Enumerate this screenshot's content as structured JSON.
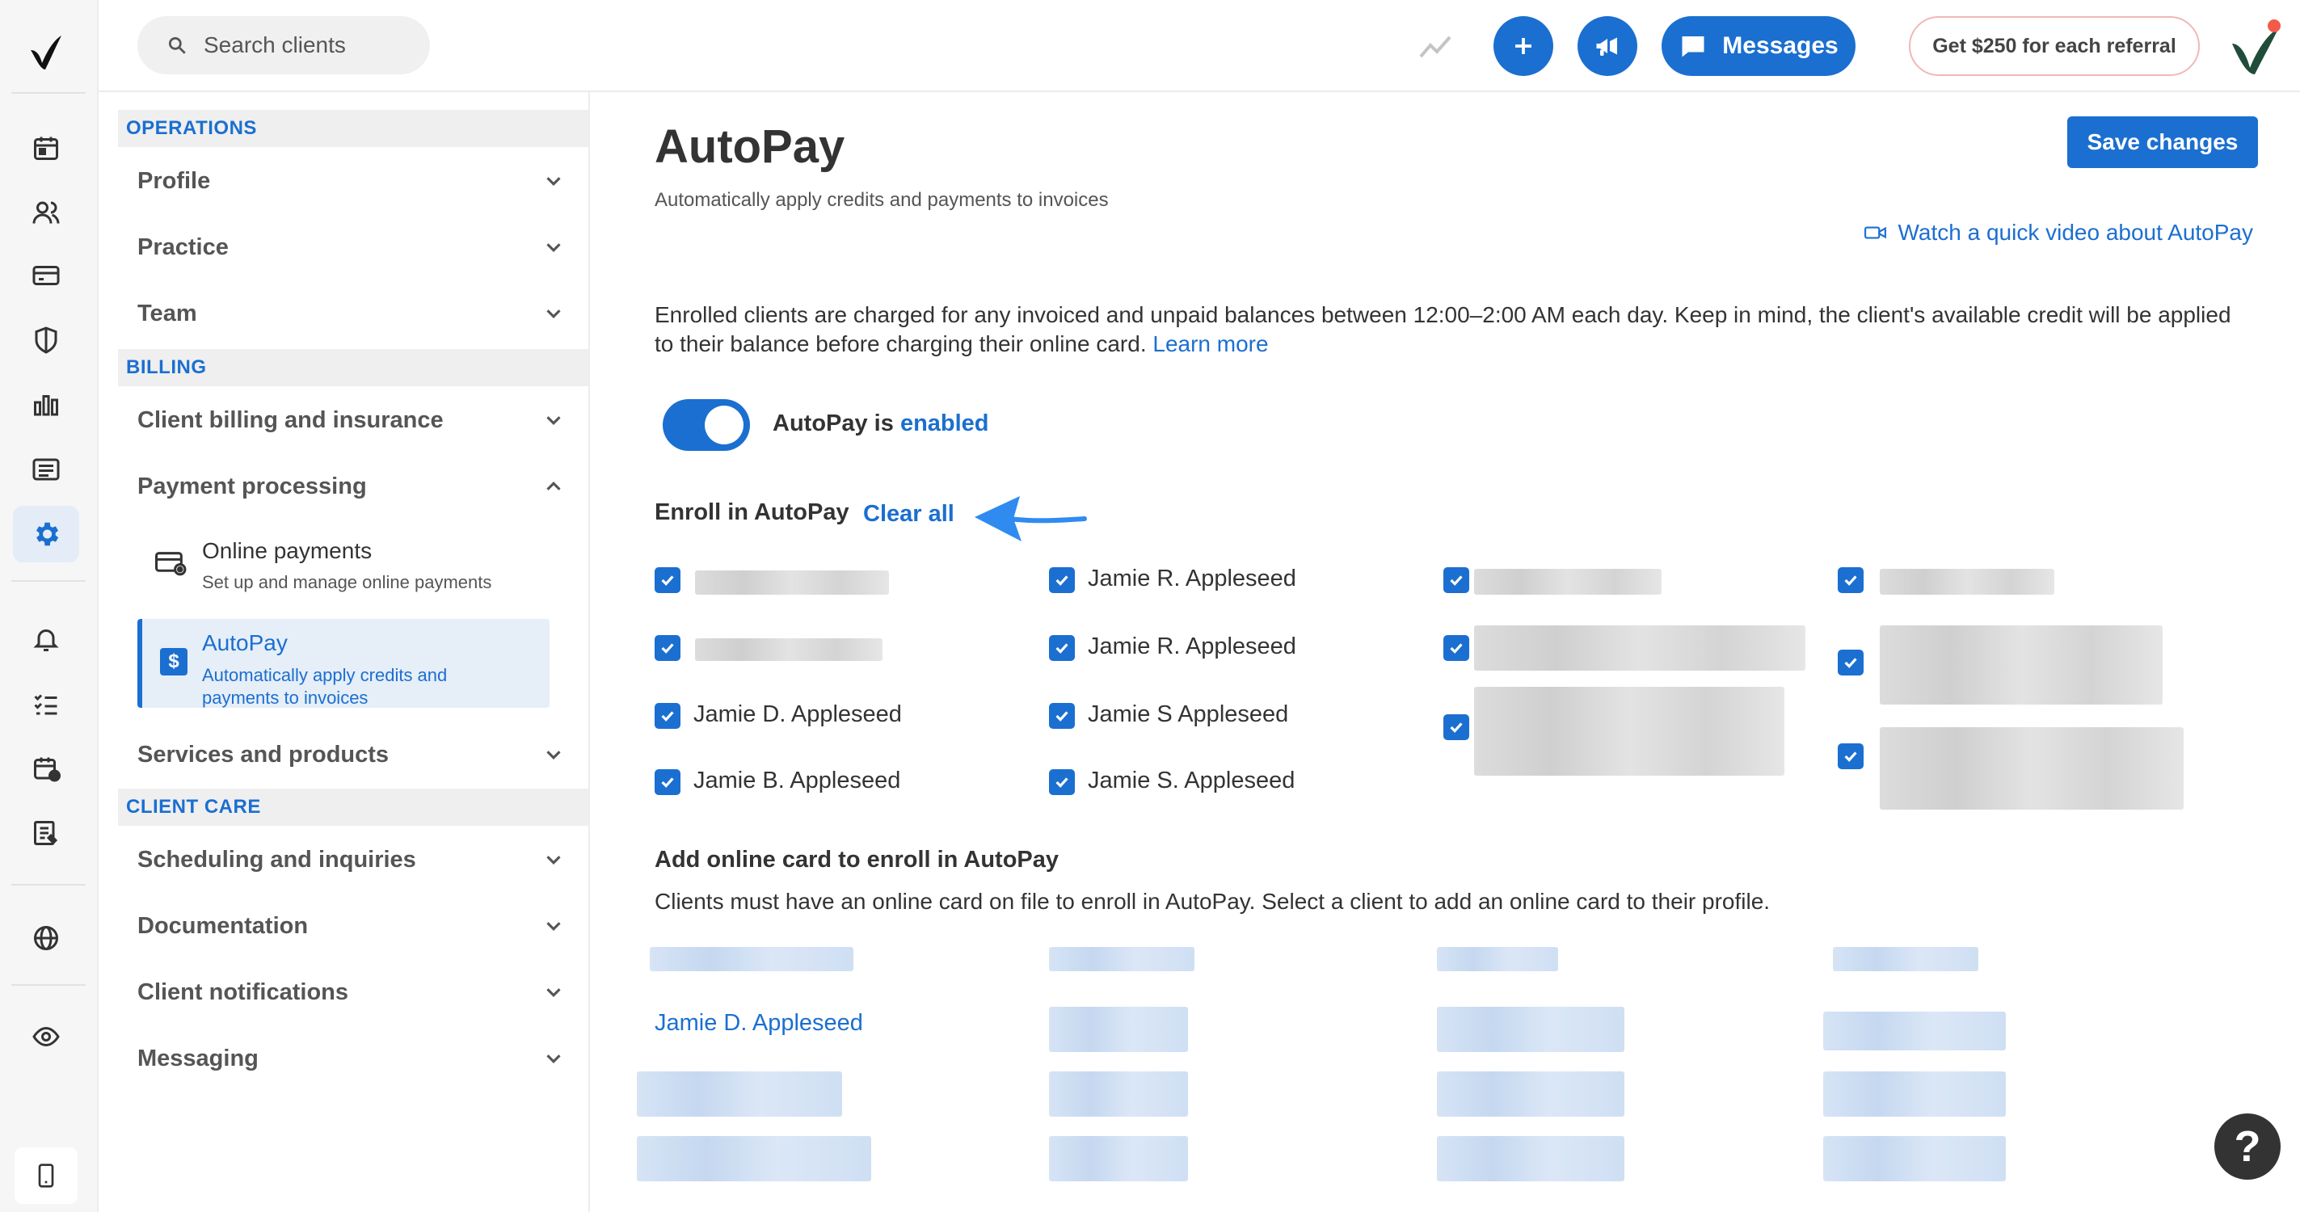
{
  "header": {
    "search_placeholder": "Search clients",
    "messages_label": "Messages",
    "referral_label": "Get $250 for each referral"
  },
  "nav": {
    "sections": {
      "operations": "OPERATIONS",
      "billing": "BILLING",
      "client_care": "CLIENT CARE"
    },
    "items": {
      "profile": "Profile",
      "practice": "Practice",
      "team": "Team",
      "client_billing": "Client billing and insurance",
      "payment_processing": "Payment processing",
      "services": "Services and products",
      "scheduling": "Scheduling and inquiries",
      "documentation": "Documentation",
      "notifications": "Client notifications",
      "messaging": "Messaging"
    },
    "sub": {
      "online_title": "Online payments",
      "online_desc": "Set up and manage online payments",
      "autopay_title": "AutoPay",
      "autopay_desc": "Automatically apply credits and payments to invoices"
    }
  },
  "main": {
    "title": "AutoPay",
    "subtitle": "Automatically apply credits and payments to invoices",
    "save_label": "Save changes",
    "video_link": "Watch a quick video about AutoPay",
    "description": "Enrolled clients are charged for any invoiced and unpaid balances between 12:00–2:00 AM each day. Keep in mind, the client's available credit will be applied to their balance before charging their online card.",
    "learn_more": "Learn more",
    "toggle_prefix": "AutoPay is",
    "toggle_state": "enabled",
    "enroll_heading": "Enroll in AutoPay",
    "clear_all": "Clear all",
    "enrolled_clients": [
      "Jamie D. Appleseed",
      "Jamie B. Appleseed",
      "Jamie R. Appleseed",
      "Jamie R. Appleseed",
      "Jamie S Appleseed",
      "Jamie S. Appleseed"
    ],
    "add_card_heading": "Add online card to enroll in AutoPay",
    "add_card_desc": "Clients must have an online card on file to enroll in AutoPay. Select a client to add an online card to their profile.",
    "add_card_client": "Jamie D. Appleseed"
  },
  "help_label": "?"
}
